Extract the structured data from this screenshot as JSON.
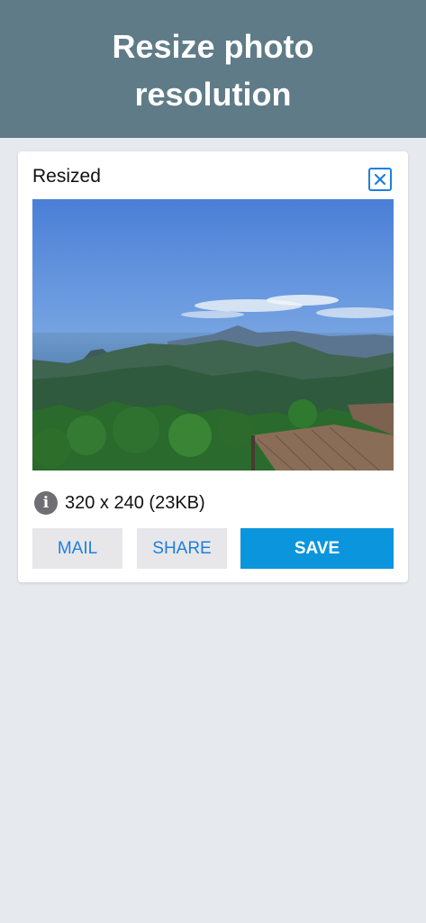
{
  "header": {
    "title": "Resize photo resolution"
  },
  "card": {
    "title": "Resized",
    "info": "320 x 240 (23KB)",
    "buttons": {
      "mail": "MAIL",
      "share": "SHARE",
      "save": "SAVE"
    }
  },
  "colors": {
    "header_bg": "#5f7b88",
    "page_bg": "#e6e9ed",
    "accent": "#1d7fe0",
    "save_bg": "#0a95dc"
  },
  "icons": {
    "close": "close-icon",
    "info": "info-icon"
  }
}
